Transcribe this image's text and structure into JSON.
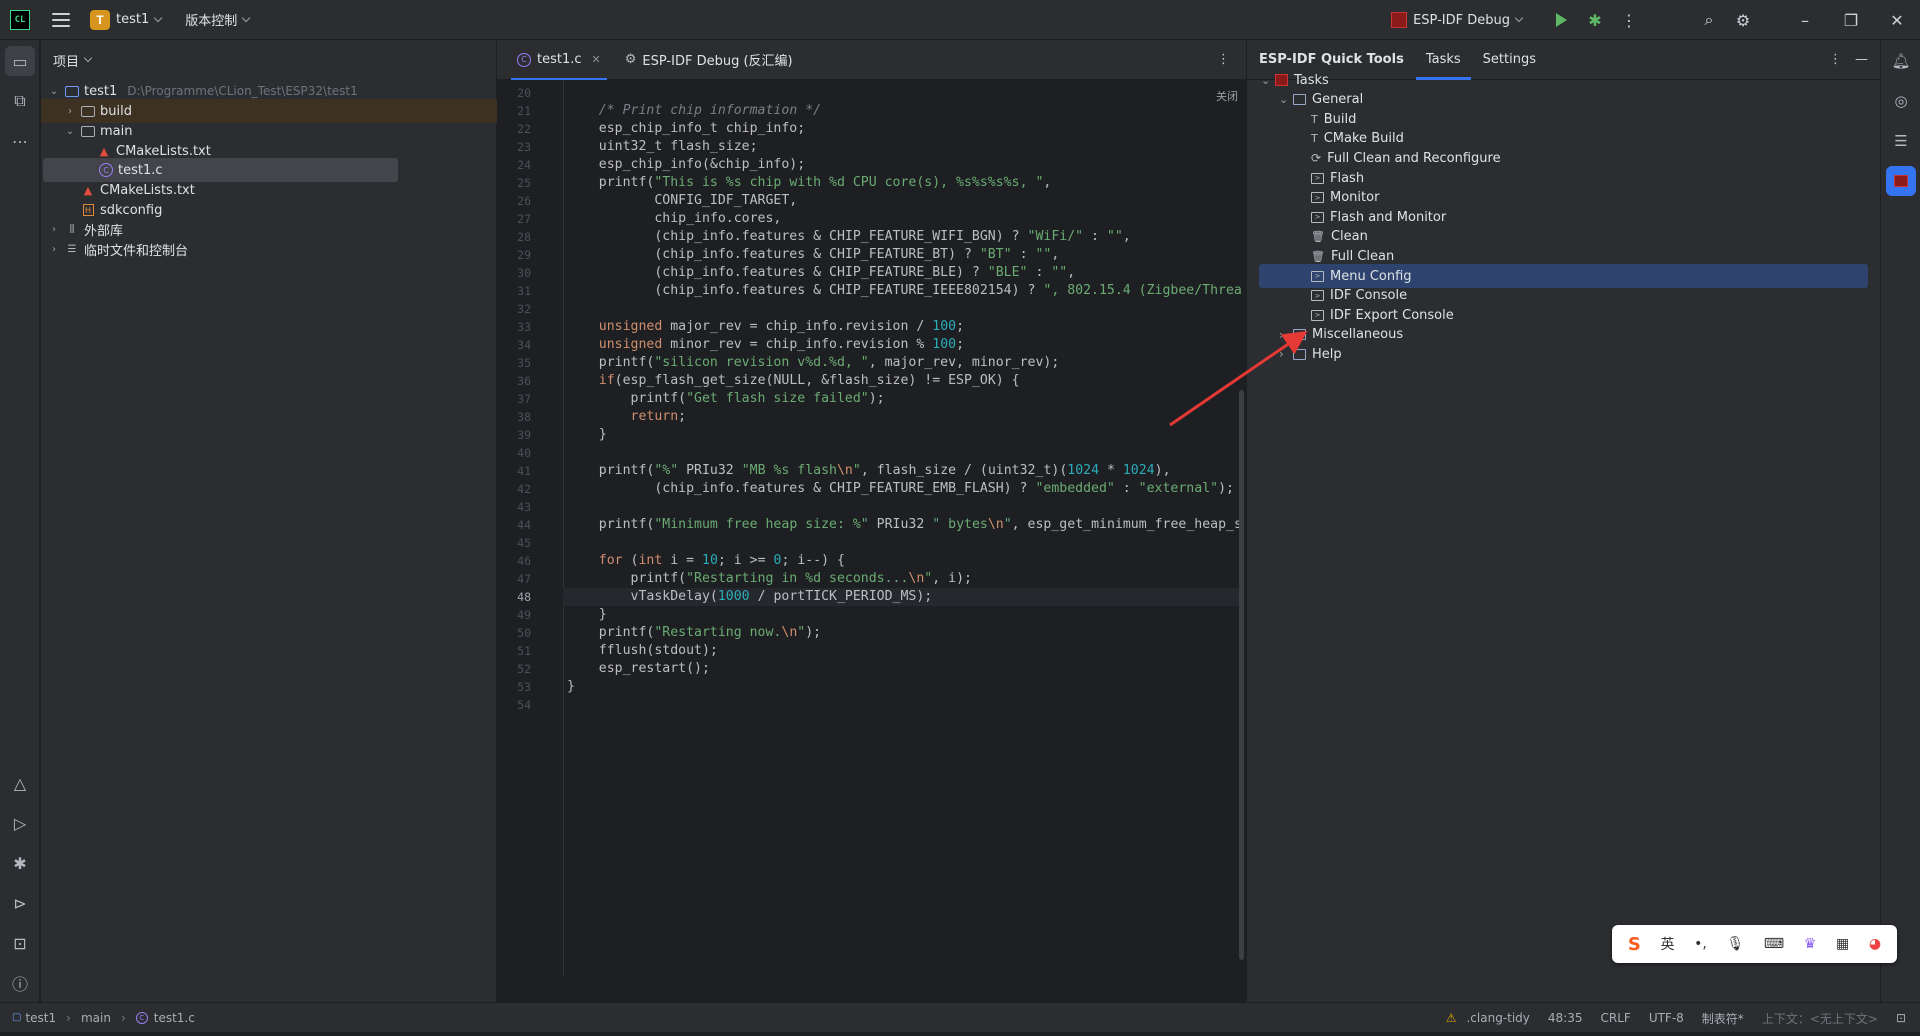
{
  "titlebar": {
    "project_badge": "T",
    "project_name": "test1",
    "vcs_label": "版本控制",
    "run_config": "ESP-IDF Debug"
  },
  "project_panel": {
    "title": "项目",
    "tree": [
      {
        "label": "test1",
        "path": "D:\\Programme\\CLion_Test\\ESP32\\test1",
        "type": "module",
        "depth": 0,
        "expanded": true
      },
      {
        "label": "build",
        "type": "folder",
        "depth": 1,
        "expanded": false
      },
      {
        "label": "main",
        "type": "folder",
        "depth": 1,
        "expanded": true
      },
      {
        "label": "CMakeLists.txt",
        "type": "cmake",
        "depth": 2
      },
      {
        "label": "test1.c",
        "type": "c-file",
        "depth": 2,
        "selected": true
      },
      {
        "label": "CMakeLists.txt",
        "type": "cmake",
        "depth": 1
      },
      {
        "label": "sdkconfig",
        "type": "config",
        "depth": 1
      },
      {
        "label": "外部库",
        "type": "library",
        "depth": 0,
        "expanded": false
      },
      {
        "label": "临时文件和控制台",
        "type": "scratches",
        "depth": 0,
        "expanded": false
      }
    ]
  },
  "editor": {
    "tabs": [
      {
        "label": "test1.c",
        "active": true
      },
      {
        "label": "ESP-IDF Debug (反汇编)",
        "active": false
      }
    ],
    "close_label": "关闭",
    "current_line": 48,
    "lines": [
      {
        "n": 20,
        "html": ""
      },
      {
        "n": 21,
        "html": "    <span class='cm'>/* Print chip information */</span>"
      },
      {
        "n": 22,
        "html": "    esp_chip_info_t chip_info;"
      },
      {
        "n": 23,
        "html": "    uint32_t flash_size;"
      },
      {
        "n": 24,
        "html": "    esp_chip_info(&amp;chip_info);"
      },
      {
        "n": 25,
        "html": "    printf(<span class='st'>\"This is %s chip with %d CPU core(s), %s%s%s%s, \"</span>,"
      },
      {
        "n": 26,
        "html": "           CONFIG_IDF_TARGET,"
      },
      {
        "n": 27,
        "html": "           chip_info.cores,"
      },
      {
        "n": 28,
        "html": "           (chip_info.features &amp; CHIP_FEATURE_WIFI_BGN) ? <span class='st'>\"WiFi/\"</span> : <span class='st'>\"\"</span>,"
      },
      {
        "n": 29,
        "html": "           (chip_info.features &amp; CHIP_FEATURE_BT) ? <span class='st'>\"BT\"</span> : <span class='st'>\"\"</span>,"
      },
      {
        "n": 30,
        "html": "           (chip_info.features &amp; CHIP_FEATURE_BLE) ? <span class='st'>\"BLE\"</span> : <span class='st'>\"\"</span>,"
      },
      {
        "n": 31,
        "html": "           (chip_info.features &amp; CHIP_FEATURE_IEEE802154) ? <span class='st'>\", 802.15.4 (Zigbee/Threa</span>"
      },
      {
        "n": 32,
        "html": ""
      },
      {
        "n": 33,
        "html": "    <span class='kw'>unsigned</span> major_rev = chip_info.revision / <span class='nu'>100</span>;"
      },
      {
        "n": 34,
        "html": "    <span class='kw'>unsigned</span> minor_rev = chip_info.revision % <span class='nu'>100</span>;"
      },
      {
        "n": 35,
        "html": "    printf(<span class='st'>\"silicon revision v%d.%d, \"</span>, major_rev, minor_rev);"
      },
      {
        "n": 36,
        "html": "    <span class='kw'>if</span>(esp_flash_get_size(NULL, &amp;flash_size) != ESP_OK) {"
      },
      {
        "n": 37,
        "html": "        printf(<span class='st'>\"Get flash size failed\"</span>);"
      },
      {
        "n": 38,
        "html": "        <span class='kw'>return</span>;"
      },
      {
        "n": 39,
        "html": "    }"
      },
      {
        "n": 40,
        "html": ""
      },
      {
        "n": 41,
        "html": "    printf(<span class='st'>\"%\"</span> PRIu32 <span class='st'>\"MB %s flash<span class='esc'>\\n</span>\"</span>, flash_size / (uint32_t)(<span class='nu'>1024</span> * <span class='nu'>1024</span>),"
      },
      {
        "n": 42,
        "html": "           (chip_info.features &amp; CHIP_FEATURE_EMB_FLASH) ? <span class='st'>\"embedded\"</span> : <span class='st'>\"external\"</span>);"
      },
      {
        "n": 43,
        "html": ""
      },
      {
        "n": 44,
        "html": "    printf(<span class='st'>\"Minimum free heap size: %\"</span> PRIu32 <span class='st'>\" bytes<span class='esc'>\\n</span>\"</span>, esp_get_minimum_free_heap_s"
      },
      {
        "n": 45,
        "html": ""
      },
      {
        "n": 46,
        "html": "    <span class='kw'>for</span> (<span class='kw'>int</span> i = <span class='nu'>10</span>; i &gt;= <span class='nu'>0</span>; i--) {"
      },
      {
        "n": 47,
        "html": "        printf(<span class='st'>\"Restarting in %d seconds...<span class='esc'>\\n</span>\"</span>, i);"
      },
      {
        "n": 48,
        "html": "        vTaskDelay(<span class='nu'>1000</span> / portTICK_PERIOD_MS);"
      },
      {
        "n": 49,
        "html": "    }"
      },
      {
        "n": 50,
        "html": "    printf(<span class='st'>\"Restarting now.<span class='esc'>\\n</span>\"</span>);"
      },
      {
        "n": 51,
        "html": "    fflush(stdout);"
      },
      {
        "n": 52,
        "html": "    esp_restart();"
      },
      {
        "n": 53,
        "html": "}"
      },
      {
        "n": 54,
        "html": ""
      }
    ]
  },
  "quick_tools": {
    "title": "ESP-IDF Quick Tools",
    "tabs": [
      {
        "label": "Tasks",
        "active": true
      },
      {
        "label": "Settings",
        "active": false
      }
    ],
    "tree": [
      {
        "label": "Tasks",
        "icon": "tasks-icon",
        "depth": 0,
        "arrow": "down"
      },
      {
        "label": "General",
        "icon": "folder-icon",
        "depth": 1,
        "arrow": "down"
      },
      {
        "label": "Build",
        "icon": "hammer-icon",
        "depth": 2
      },
      {
        "label": "CMake Build",
        "icon": "hammer-icon",
        "depth": 2
      },
      {
        "label": "Full Clean and Reconfigure",
        "icon": "refresh-icon",
        "depth": 2
      },
      {
        "label": "Flash",
        "icon": "terminal-icon",
        "depth": 2
      },
      {
        "label": "Monitor",
        "icon": "terminal-icon",
        "depth": 2
      },
      {
        "label": "Flash and Monitor",
        "icon": "terminal-icon",
        "depth": 2
      },
      {
        "label": "Clean",
        "icon": "trash-icon",
        "depth": 2
      },
      {
        "label": "Full Clean",
        "icon": "trash-icon",
        "depth": 2
      },
      {
        "label": "Menu Config",
        "icon": "terminal-icon",
        "depth": 2,
        "selected": true
      },
      {
        "label": "IDF Console",
        "icon": "terminal-icon",
        "depth": 2
      },
      {
        "label": "IDF Export Console",
        "icon": "terminal-icon",
        "depth": 2
      },
      {
        "label": "Miscellaneous",
        "icon": "folder-icon",
        "depth": 1,
        "arrow": "right"
      },
      {
        "label": "Help",
        "icon": "folder-icon",
        "depth": 1,
        "arrow": "right"
      }
    ]
  },
  "statusbar": {
    "breadcrumb": [
      "test1",
      "main",
      "test1.c"
    ],
    "inspector": ".clang-tidy",
    "position": "48:35",
    "line_sep": "CRLF",
    "encoding": "UTF-8",
    "indent": "制表符*",
    "context": "上下文：<无上下文>"
  },
  "ime_toolbar": {
    "lang": "英"
  },
  "colors": {
    "accent": "#3574f0",
    "annotation_arrow": "#e53935",
    "selection": "#2e436e"
  }
}
